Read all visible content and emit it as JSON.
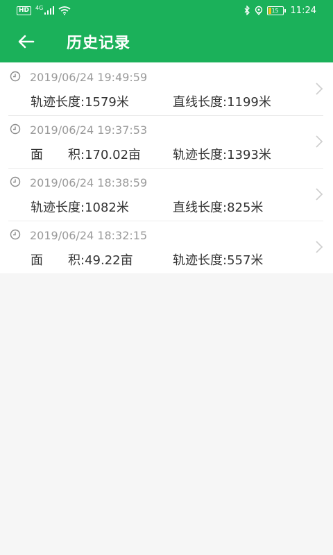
{
  "status_bar": {
    "hd": "HD",
    "network": "4G",
    "battery": "15",
    "time": "11:24"
  },
  "header": {
    "title": "历史记录"
  },
  "records": [
    {
      "time": "2019/06/24 19:49:59",
      "metric1": "轨迹长度:1579米",
      "metric2": "直线长度:1199米"
    },
    {
      "time": "2019/06/24 19:37:53",
      "metric1": "面　　积:170.02亩",
      "metric2": "轨迹长度:1393米"
    },
    {
      "time": "2019/06/24 18:38:59",
      "metric1": "轨迹长度:1082米",
      "metric2": "直线长度:825米"
    },
    {
      "time": "2019/06/24 18:32:15",
      "metric1": "面　　积:49.22亩",
      "metric2": "轨迹长度:557米"
    }
  ],
  "icons": {
    "back": "arrow-left-icon",
    "clock": "clock-icon",
    "chevron": "chevron-right-icon",
    "signal": "signal-icon",
    "wifi": "wifi-icon",
    "bluetooth": "bluetooth-icon",
    "location": "location-icon",
    "battery": "battery-icon"
  },
  "colors": {
    "brand_green": "#1bb15a",
    "background": "#f6f6f6",
    "timestamp_gray": "#9a9a9a",
    "text_dark": "#333333"
  }
}
